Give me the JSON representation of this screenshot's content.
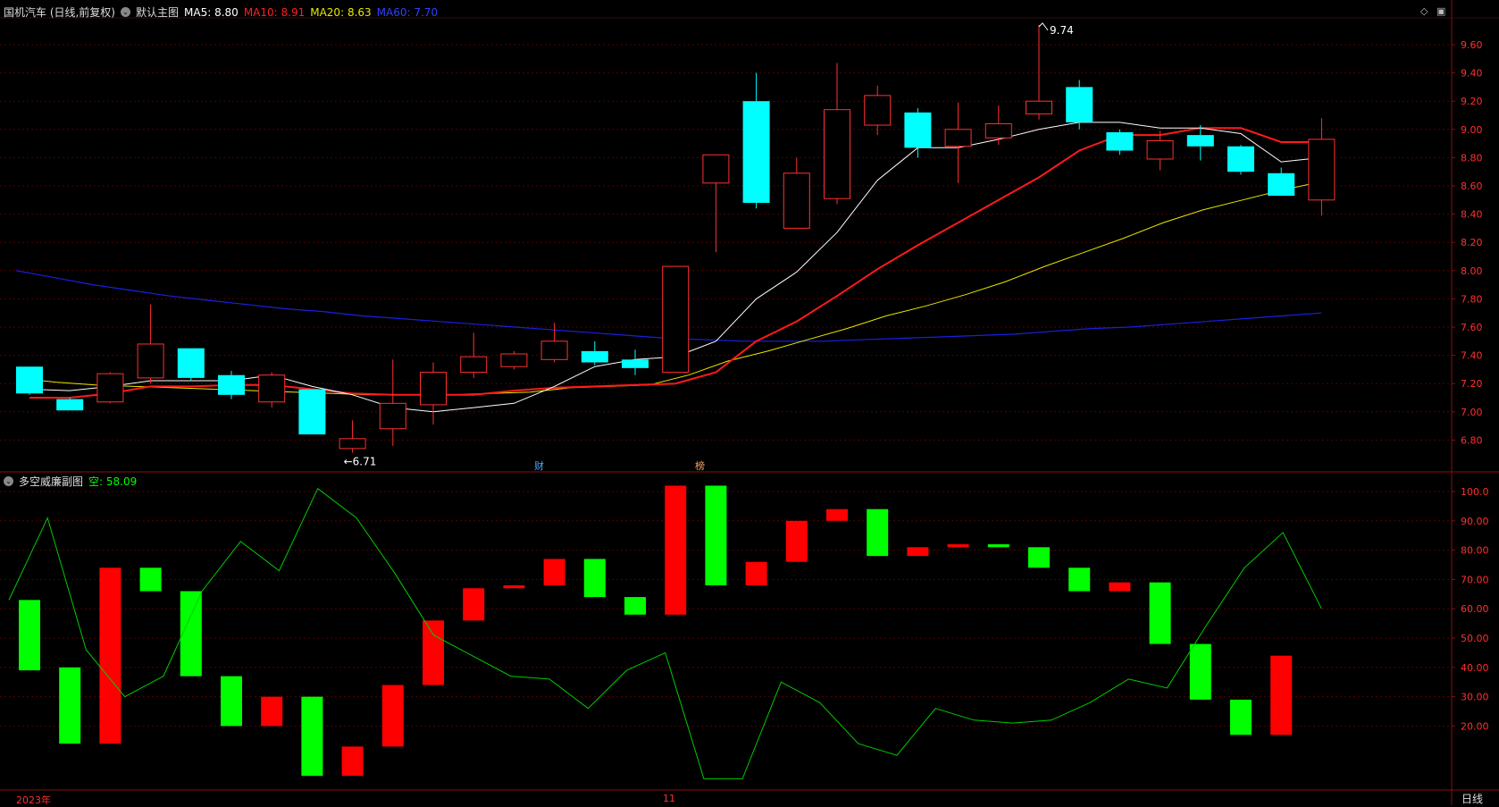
{
  "header": {
    "title": "国机汽车 (日线,前复权)",
    "chart_menu": "默认主图",
    "ma5": {
      "label": "MA5:",
      "value": "8.80",
      "color": "#ffffff"
    },
    "ma10": {
      "label": "MA10:",
      "value": "8.91",
      "color": "#ff2020"
    },
    "ma20": {
      "label": "MA20:",
      "value": "8.63",
      "color": "#e8e800"
    },
    "ma60": {
      "label": "MA60:",
      "value": "7.70",
      "color": "#2030ff"
    }
  },
  "sub_header": {
    "title": "多空威廉副图",
    "indicator_label": "空:",
    "indicator_value": "58.09",
    "indicator_color": "#00ff00"
  },
  "markers": {
    "fin": "财",
    "bang": "榜"
  },
  "timeline": {
    "year": "2023年",
    "month": "11"
  },
  "period_tab": "日线",
  "icons": [
    "collapse-icon",
    "sub-collapse-icon",
    "diamond-icon",
    "restore-icon"
  ],
  "chart_data": [
    {
      "type": "candlestick",
      "price_axis": {
        "range": [
          6.6,
          9.8
        ],
        "ticks": [
          "9.60",
          "9.40",
          "9.20",
          "9.00",
          "8.80",
          "8.60",
          "8.40",
          "8.20",
          "8.00",
          "7.80",
          "7.60",
          "7.40",
          "7.20",
          "7.00",
          "6.80"
        ]
      },
      "candles": [
        {
          "o": 7.32,
          "h": 7.32,
          "l": 7.12,
          "c": 7.13
        },
        {
          "o": 7.09,
          "h": 7.1,
          "l": 7.01,
          "c": 7.01
        },
        {
          "o": 7.07,
          "h": 7.28,
          "l": 7.06,
          "c": 7.27
        },
        {
          "o": 7.24,
          "h": 7.76,
          "l": 7.2,
          "c": 7.48
        },
        {
          "o": 7.45,
          "h": 7.45,
          "l": 7.22,
          "c": 7.24
        },
        {
          "o": 7.26,
          "h": 7.29,
          "l": 7.09,
          "c": 7.12
        },
        {
          "o": 7.07,
          "h": 7.28,
          "l": 7.03,
          "c": 7.26
        },
        {
          "o": 7.16,
          "h": 7.16,
          "l": 6.84,
          "c": 6.84
        },
        {
          "o": 6.74,
          "h": 6.94,
          "l": 6.71,
          "c": 6.81
        },
        {
          "o": 6.88,
          "h": 7.37,
          "l": 6.76,
          "c": 7.06
        },
        {
          "o": 7.05,
          "h": 7.35,
          "l": 6.91,
          "c": 7.28
        },
        {
          "o": 7.28,
          "h": 7.56,
          "l": 7.24,
          "c": 7.39
        },
        {
          "o": 7.32,
          "h": 7.43,
          "l": 7.3,
          "c": 7.41
        },
        {
          "o": 7.37,
          "h": 7.63,
          "l": 7.35,
          "c": 7.5
        },
        {
          "o": 7.43,
          "h": 7.5,
          "l": 7.33,
          "c": 7.35
        },
        {
          "o": 7.37,
          "h": 7.44,
          "l": 7.26,
          "c": 7.31
        },
        {
          "o": 7.28,
          "h": 8.03,
          "l": 7.28,
          "c": 8.03
        },
        {
          "o": 8.62,
          "h": 8.82,
          "l": 8.13,
          "c": 8.82
        },
        {
          "o": 9.2,
          "h": 9.4,
          "l": 8.44,
          "c": 8.48
        },
        {
          "o": 8.3,
          "h": 8.8,
          "l": 8.3,
          "c": 8.69
        },
        {
          "o": 8.51,
          "h": 9.47,
          "l": 8.47,
          "c": 9.14
        },
        {
          "o": 9.03,
          "h": 9.31,
          "l": 8.96,
          "c": 9.24
        },
        {
          "o": 9.12,
          "h": 9.15,
          "l": 8.8,
          "c": 8.87
        },
        {
          "o": 8.88,
          "h": 9.19,
          "l": 8.62,
          "c": 9.0
        },
        {
          "o": 8.94,
          "h": 9.17,
          "l": 8.89,
          "c": 9.04
        },
        {
          "o": 9.11,
          "h": 9.74,
          "l": 9.07,
          "c": 9.2
        },
        {
          "o": 9.3,
          "h": 9.35,
          "l": 9.0,
          "c": 9.05
        },
        {
          "o": 8.98,
          "h": 9.0,
          "l": 8.82,
          "c": 8.85
        },
        {
          "o": 8.79,
          "h": 8.99,
          "l": 8.71,
          "c": 8.92
        },
        {
          "o": 8.96,
          "h": 9.03,
          "l": 8.78,
          "c": 8.88
        },
        {
          "o": 8.88,
          "h": 8.89,
          "l": 8.68,
          "c": 8.7
        },
        {
          "o": 8.69,
          "h": 8.73,
          "l": 8.53,
          "c": 8.53
        },
        {
          "o": 8.5,
          "h": 9.08,
          "l": 8.39,
          "c": 8.93
        }
      ],
      "ma5": [
        7.16,
        7.15,
        7.18,
        7.22,
        7.22,
        7.22,
        7.26,
        7.18,
        7.12,
        7.03,
        7.0,
        7.03,
        7.06,
        7.18,
        7.32,
        7.37,
        7.39,
        7.5,
        7.8,
        7.99,
        8.27,
        8.64,
        8.87,
        8.87,
        8.93,
        9.0,
        9.05,
        9.05,
        9.01,
        9.01,
        8.97,
        8.77,
        8.8
      ],
      "ma10": [
        7.1,
        7.1,
        7.13,
        7.18,
        7.18,
        7.19,
        7.19,
        7.16,
        7.13,
        7.12,
        7.12,
        7.12,
        7.15,
        7.17,
        7.18,
        7.19,
        7.2,
        7.28,
        7.5,
        7.64,
        7.82,
        8.01,
        8.18,
        8.34,
        8.5,
        8.66,
        8.85,
        8.96,
        8.96,
        9.01,
        9.01,
        8.91,
        8.91
      ],
      "ma20": [
        7.24,
        7.21,
        7.19,
        7.18,
        7.17,
        7.16,
        7.15,
        7.14,
        7.13,
        7.12,
        7.12,
        7.12,
        7.13,
        7.14,
        7.17,
        7.18,
        7.19,
        7.26,
        7.36,
        7.43,
        7.51,
        7.59,
        7.68,
        7.75,
        7.83,
        7.92,
        8.03,
        8.13,
        8.23,
        8.34,
        8.43,
        8.5,
        8.57,
        8.63
      ],
      "ma60": [
        8.0,
        7.95,
        7.9,
        7.86,
        7.82,
        7.79,
        7.76,
        7.73,
        7.71,
        7.68,
        7.66,
        7.64,
        7.62,
        7.6,
        7.58,
        7.56,
        7.54,
        7.52,
        7.51,
        7.5,
        7.5,
        7.5,
        7.51,
        7.52,
        7.53,
        7.54,
        7.55,
        7.57,
        7.59,
        7.6,
        7.62,
        7.64,
        7.66,
        7.68,
        7.7
      ],
      "annotations": [
        {
          "index": 8,
          "price": 6.71,
          "label": "←6.71"
        },
        {
          "index": 25,
          "price": 9.74,
          "label": "9.74"
        }
      ]
    },
    {
      "type": "bar",
      "title": "多空威廉副图",
      "value_axis": {
        "range": [
          0,
          103
        ],
        "ticks": [
          "100.0",
          "90.00",
          "80.00",
          "70.00",
          "60.00",
          "50.00",
          "40.00",
          "30.00",
          "20.00"
        ]
      },
      "bars": [
        {
          "from": 39,
          "to": 63,
          "color": "green"
        },
        {
          "from": 14,
          "to": 40,
          "color": "green"
        },
        {
          "from": 14,
          "to": 74,
          "color": "red"
        },
        {
          "from": 66,
          "to": 74,
          "color": "green"
        },
        {
          "from": 37,
          "to": 66,
          "color": "green"
        },
        {
          "from": 20,
          "to": 37,
          "color": "green"
        },
        {
          "from": 20,
          "to": 30,
          "color": "red"
        },
        {
          "from": 3,
          "to": 30,
          "color": "green"
        },
        {
          "from": 3,
          "to": 13,
          "color": "red"
        },
        {
          "from": 13,
          "to": 34,
          "color": "red"
        },
        {
          "from": 34,
          "to": 56,
          "color": "red"
        },
        {
          "from": 56,
          "to": 67,
          "color": "red"
        },
        {
          "from": 67,
          "to": 68,
          "color": "red"
        },
        {
          "from": 68,
          "to": 77,
          "color": "red"
        },
        {
          "from": 64,
          "to": 77,
          "color": "green"
        },
        {
          "from": 58,
          "to": 64,
          "color": "green"
        },
        {
          "from": 58,
          "to": 102,
          "color": "red"
        },
        {
          "from": 68,
          "to": 102,
          "color": "green"
        },
        {
          "from": 68,
          "to": 76,
          "color": "red"
        },
        {
          "from": 76,
          "to": 90,
          "color": "red"
        },
        {
          "from": 90,
          "to": 94,
          "color": "red"
        },
        {
          "from": 78,
          "to": 94,
          "color": "green"
        },
        {
          "from": 78,
          "to": 81,
          "color": "red"
        },
        {
          "from": 81,
          "to": 82,
          "color": "red"
        },
        {
          "from": 81,
          "to": 82,
          "color": "green"
        },
        {
          "from": 74,
          "to": 81,
          "color": "green"
        },
        {
          "from": 66,
          "to": 74,
          "color": "green"
        },
        {
          "from": 66,
          "to": 69,
          "color": "red"
        },
        {
          "from": 48,
          "to": 69,
          "color": "green"
        },
        {
          "from": 29,
          "to": 48,
          "color": "green"
        },
        {
          "from": 17,
          "to": 29,
          "color": "green"
        },
        {
          "from": 17,
          "to": 44,
          "color": "red"
        }
      ],
      "line": [
        63,
        91,
        46,
        30,
        37,
        66,
        83,
        73,
        101,
        91,
        72,
        51,
        44,
        37,
        36,
        26,
        39,
        45,
        2,
        2,
        35,
        28,
        14,
        10,
        26,
        22,
        21,
        22,
        28,
        36,
        33,
        54,
        74,
        86,
        60
      ]
    }
  ]
}
